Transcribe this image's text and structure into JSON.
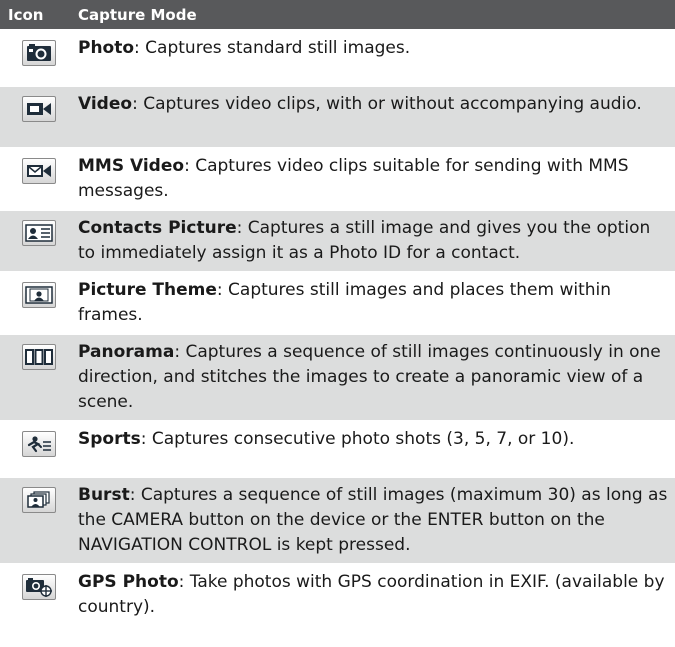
{
  "header": {
    "icon_col": "Icon",
    "mode_col": "Capture Mode"
  },
  "rows": [
    {
      "icon": "camera-icon",
      "name": "Photo",
      "desc": ": Captures standard still images."
    },
    {
      "icon": "video-camera-icon",
      "name": "Video",
      "desc": ": Captures video clips, with or without accompanying audio."
    },
    {
      "icon": "mms-video-icon",
      "name": "MMS Video",
      "desc": ": Captures video clips suitable for sending with MMS messages."
    },
    {
      "icon": "contact-card-icon",
      "name": "Contacts Picture",
      "desc": ": Captures a still image and gives you the option to immediately assign it as a Photo ID for a contact."
    },
    {
      "icon": "picture-frame-icon",
      "name": "Picture Theme",
      "desc": ": Captures still images and places them within frames."
    },
    {
      "icon": "panorama-icon",
      "name": "Panorama",
      "desc": ": Captures a sequence of still images continuously in one direction, and stitches the images to create a panoramic view of a scene."
    },
    {
      "icon": "sports-icon",
      "name": "Sports",
      "desc": ": Captures consecutive photo shots (3, 5, 7, or 10)."
    },
    {
      "icon": "burst-icon",
      "name": "Burst",
      "desc": ": Captures a sequence of still images (maximum 30) as long as the CAMERA button on the device or the ENTER button on the NAVIGATION CONTROL is kept pressed."
    },
    {
      "icon": "gps-photo-icon",
      "name": "GPS Photo",
      "desc": ": Take photos with GPS coordination in EXIF. (available by country)."
    }
  ]
}
